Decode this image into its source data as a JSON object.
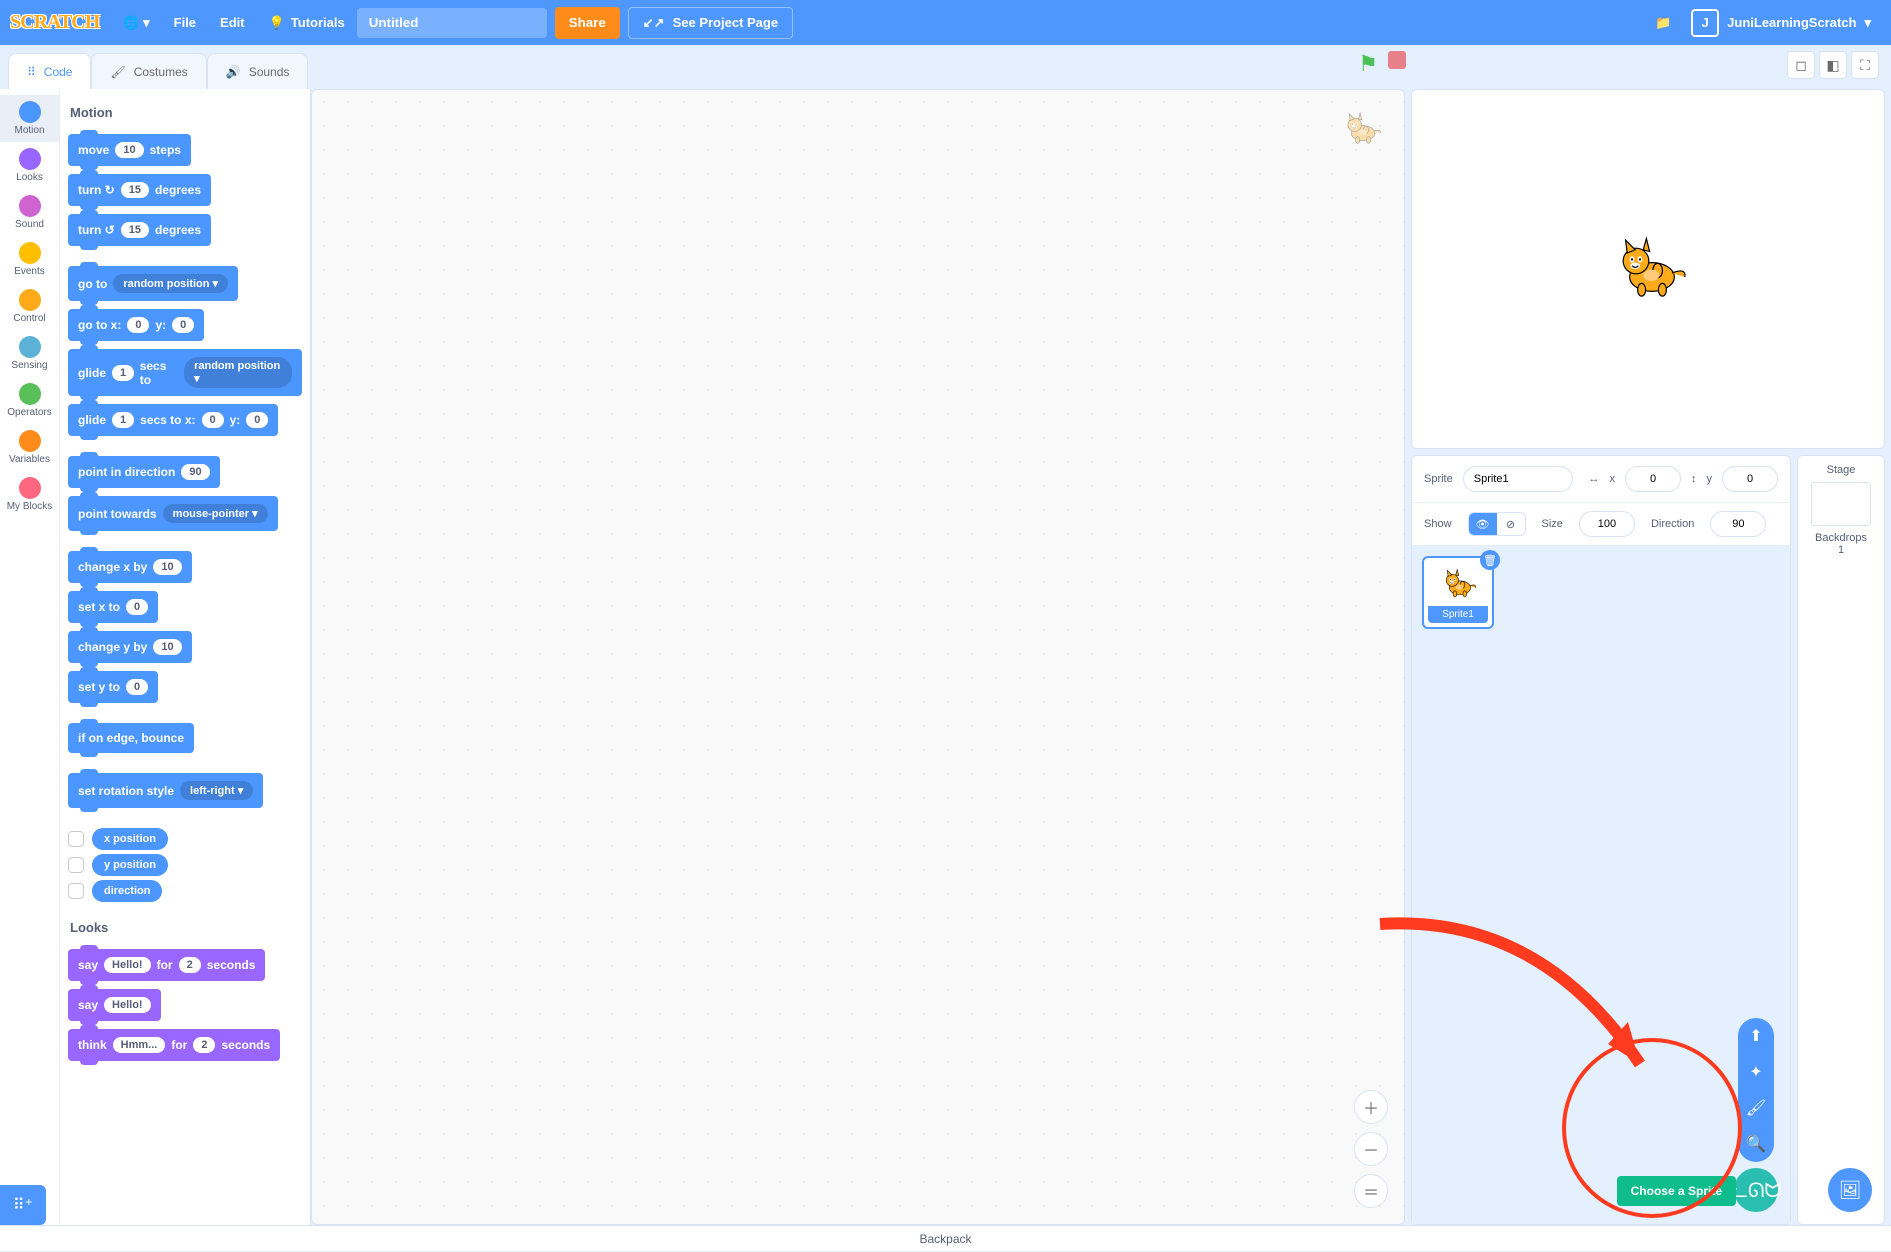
{
  "menubar": {
    "logo": "SCRATCH",
    "file": "File",
    "edit": "Edit",
    "tutorials": "Tutorials",
    "title_value": "Untitled",
    "share": "Share",
    "see_project": "See Project Page",
    "username": "JuniLearningScratch",
    "avatar_letter": "J"
  },
  "tabs": {
    "code": "Code",
    "costumes": "Costumes",
    "sounds": "Sounds"
  },
  "categories": [
    {
      "name": "Motion",
      "color": "#4c97ff"
    },
    {
      "name": "Looks",
      "color": "#9966ff"
    },
    {
      "name": "Sound",
      "color": "#cf63cf"
    },
    {
      "name": "Events",
      "color": "#ffbf00"
    },
    {
      "name": "Control",
      "color": "#ffab19"
    },
    {
      "name": "Sensing",
      "color": "#5cb1d6"
    },
    {
      "name": "Operators",
      "color": "#59c059"
    },
    {
      "name": "Variables",
      "color": "#ff8c1a"
    },
    {
      "name": "My Blocks",
      "color": "#ff6680"
    }
  ],
  "palette": {
    "motion_header": "Motion",
    "looks_header": "Looks",
    "blocks": {
      "move": {
        "pre": "move",
        "val": "10",
        "post": "steps"
      },
      "turn_cw": {
        "pre": "turn ↻",
        "val": "15",
        "post": "degrees"
      },
      "turn_ccw": {
        "pre": "turn ↺",
        "val": "15",
        "post": "degrees"
      },
      "goto_menu": {
        "pre": "go to",
        "menu": "random position ▾"
      },
      "goto_xy": {
        "pre": "go to x:",
        "x": "0",
        "mid": "y:",
        "y": "0"
      },
      "glide_menu": {
        "pre": "glide",
        "secs": "1",
        "mid": "secs to",
        "menu": "random position ▾"
      },
      "glide_xy": {
        "pre": "glide",
        "secs": "1",
        "mid": "secs to x:",
        "x": "0",
        "mid2": "y:",
        "y": "0"
      },
      "point_dir": {
        "pre": "point in direction",
        "val": "90"
      },
      "point_towards": {
        "pre": "point towards",
        "menu": "mouse-pointer ▾"
      },
      "change_x": {
        "pre": "change x by",
        "val": "10"
      },
      "set_x": {
        "pre": "set x to",
        "val": "0"
      },
      "change_y": {
        "pre": "change y by",
        "val": "10"
      },
      "set_y": {
        "pre": "set y to",
        "val": "0"
      },
      "if_edge": {
        "pre": "if on edge, bounce"
      },
      "rot_style": {
        "pre": "set rotation style",
        "menu": "left-right ▾"
      },
      "rep_xpos": "x position",
      "rep_ypos": "y position",
      "rep_dir": "direction",
      "say_secs": {
        "pre": "say",
        "msg": "Hello!",
        "mid": "for",
        "secs": "2",
        "post": "seconds"
      },
      "say": {
        "pre": "say",
        "msg": "Hello!"
      },
      "think_secs": {
        "pre": "think",
        "msg": "Hmm...",
        "mid": "for",
        "secs": "2",
        "post": "seconds"
      }
    }
  },
  "sprite_info": {
    "label_sprite": "Sprite",
    "name": "Sprite1",
    "x_label": "x",
    "x": "0",
    "y_label": "y",
    "y": "0",
    "show_label": "Show",
    "size_label": "Size",
    "size": "100",
    "dir_label": "Direction",
    "dir": "90"
  },
  "sprite_thumb": {
    "label": "Sprite1"
  },
  "stage_side": {
    "title": "Stage",
    "backdrops_label": "Backdrops",
    "backdrops_count": "1"
  },
  "choose_sprite": "Choose a Sprite",
  "backpack": "Backpack"
}
